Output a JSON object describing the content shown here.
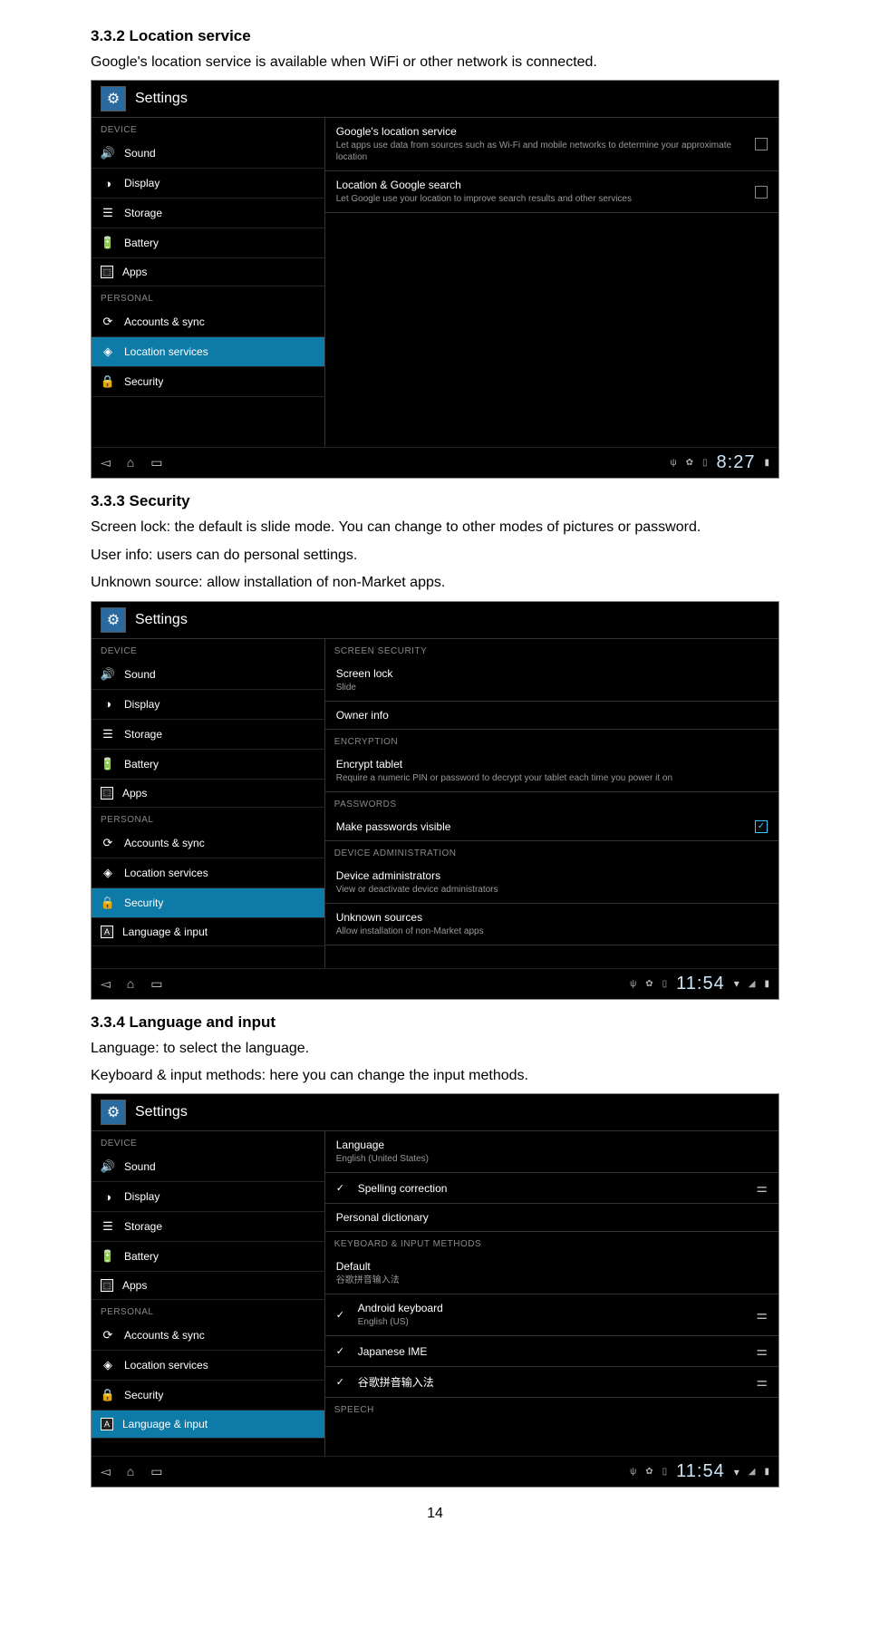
{
  "sec1": {
    "heading": "3.3.2 Location service",
    "text": "Google's location service is available when WiFi or other network is connected."
  },
  "sec2": {
    "heading": "3.3.3 Security",
    "line1": "Screen lock: the default is slide mode. You can change to other modes of pictures or password.",
    "line2": "User info: users can do personal settings.",
    "line3": "Unknown source: allow installation of non-Market apps."
  },
  "sec3": {
    "heading": "3.3.4 Language and input",
    "line1": "Language: to select the language.",
    "line2": "Keyboard & input methods: here you can change the input methods."
  },
  "settings_title": "Settings",
  "sidebar": {
    "device": "DEVICE",
    "personal": "PERSONAL",
    "sound": "Sound",
    "display": "Display",
    "storage": "Storage",
    "battery": "Battery",
    "apps": "Apps",
    "accounts": "Accounts & sync",
    "location": "Location services",
    "security": "Security",
    "language": "Language & input"
  },
  "shot1": {
    "row1_title": "Google's location service",
    "row1_sub": "Let apps use data from sources such as Wi-Fi and mobile networks to determine your approximate location",
    "row2_title": "Location & Google search",
    "row2_sub": "Let Google use your location to improve search results and other services",
    "time": "8:27"
  },
  "shot2": {
    "cat_screen": "SCREEN SECURITY",
    "row1_title": "Screen lock",
    "row1_sub": "Slide",
    "row2_title": "Owner info",
    "cat_enc": "ENCRYPTION",
    "row3_title": "Encrypt tablet",
    "row3_sub": "Require a numeric PIN or password to decrypt your tablet each time you power it on",
    "cat_pw": "PASSWORDS",
    "row4_title": "Make passwords visible",
    "cat_admin": "DEVICE ADMINISTRATION",
    "row5_title": "Device administrators",
    "row5_sub": "View or deactivate device administrators",
    "row6_title": "Unknown sources",
    "row6_sub": "Allow installation of non-Market apps",
    "time": "11:54"
  },
  "shot3": {
    "row1_title": "Language",
    "row1_sub": "English (United States)",
    "row2_title": "Spelling correction",
    "row3_title": "Personal dictionary",
    "cat_kb": "KEYBOARD & INPUT METHODS",
    "row4_title": "Default",
    "row4_sub": "谷歌拼音输入法",
    "row5_title": "Android keyboard",
    "row5_sub": "English (US)",
    "row6_title": "Japanese IME",
    "row7_title": "谷歌拼音输入法",
    "cat_speech": "SPEECH",
    "time": "11:54"
  },
  "page_number": "14"
}
